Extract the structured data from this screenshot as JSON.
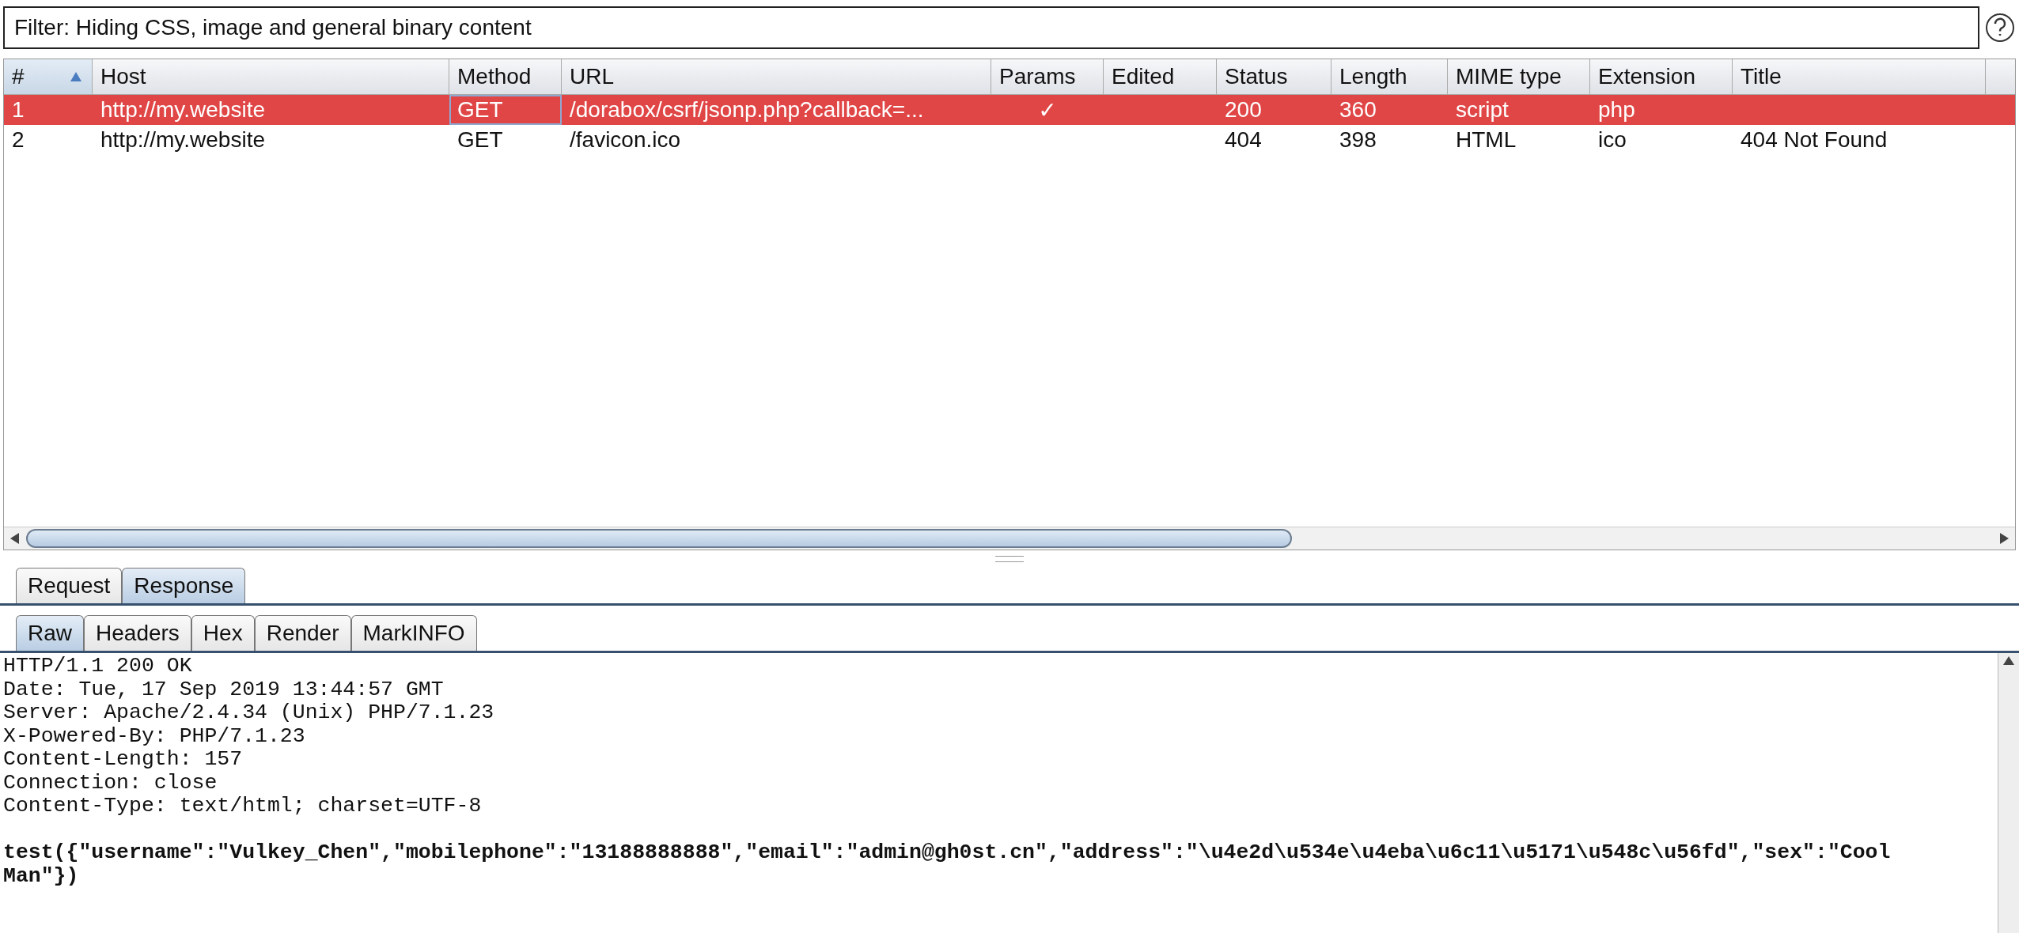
{
  "filter": {
    "label": "Filter: Hiding CSS, image and general binary content"
  },
  "table": {
    "columns": [
      {
        "label": "#",
        "sorted": true
      },
      {
        "label": "Host",
        "sorted": false
      },
      {
        "label": "Method",
        "sorted": false
      },
      {
        "label": "URL",
        "sorted": false
      },
      {
        "label": "Params",
        "sorted": false
      },
      {
        "label": "Edited",
        "sorted": false
      },
      {
        "label": "Status",
        "sorted": false
      },
      {
        "label": "Length",
        "sorted": false
      },
      {
        "label": "MIME type",
        "sorted": false
      },
      {
        "label": "Extension",
        "sorted": false
      },
      {
        "label": "Title",
        "sorted": false
      }
    ],
    "rows": [
      {
        "selected": true,
        "cells": [
          "1",
          "http://my.website",
          "GET",
          "/dorabox/csrf/jsonp.php?callback=...",
          "✓",
          "",
          "200",
          "360",
          "script",
          "php",
          ""
        ]
      },
      {
        "selected": false,
        "cells": [
          "2",
          "http://my.website",
          "GET",
          "/favicon.ico",
          "",
          "",
          "404",
          "398",
          "HTML",
          "ico",
          "404 Not Found"
        ]
      }
    ]
  },
  "tabs": [
    {
      "label": "Request",
      "selected": false
    },
    {
      "label": "Response",
      "selected": true
    }
  ],
  "subtabs": [
    {
      "label": "Raw",
      "selected": true
    },
    {
      "label": "Headers",
      "selected": false
    },
    {
      "label": "Hex",
      "selected": false
    },
    {
      "label": "Render",
      "selected": false
    },
    {
      "label": "MarkINFO",
      "selected": false
    }
  ],
  "response": {
    "headers": [
      "HTTP/1.1 200 OK",
      "Date: Tue, 17 Sep 2019 13:44:57 GMT",
      "Server: Apache/2.4.34 (Unix) PHP/7.1.23",
      "X-Powered-By: PHP/7.1.23",
      "Content-Length: 157",
      "Connection: close",
      "Content-Type: text/html; charset=UTF-8"
    ],
    "body": "test({\"username\":\"Vulkey_Chen\",\"mobilephone\":\"13188888888\",\"email\":\"admin@gh0st.cn\",\"address\":\"\\u4e2d\\u534e\\u4eba\\u6c11\\u5171\\u548c\\u56fd\",\"sex\":\"Cool Man\"})"
  }
}
